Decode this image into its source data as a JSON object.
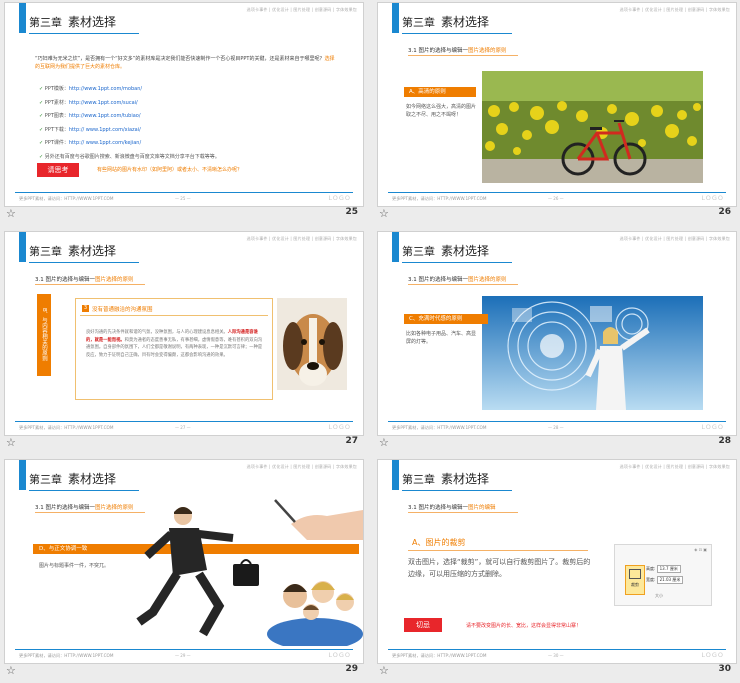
{
  "common": {
    "chapter_label": "第三章",
    "chapter_title": "素材选择",
    "top_nav": "选项卡事件 | 优化设计 | 图片处理 | 创意源码 | 字体效果包",
    "footer_text": "更多PPT素材，请访问：HTTP://WWW.1PPT.COM",
    "logo": "LOGO",
    "section_prefix": "3.1 图片的选择与编辑一",
    "section_highlight": "图片选择的原则",
    "section_highlight_30": "图片的编辑",
    "star_icon": "☆"
  },
  "slides": [
    {
      "page": "25",
      "footer_page": "— 25 —",
      "intro": "“巧妇难为无米之炊”，是否拥有一个“好文多”的素材库是决定我们能否快速制作一个否心视目PPT的关键，还是素材来自于哪里呢？",
      "intro_highlight": "选择的互联网为我们提供了巨大的素材仓库。",
      "links": [
        {
          "label": "PPT模板：",
          "url": "http://www.1ppt.com/moban/"
        },
        {
          "label": "PPT素材：",
          "url": "http://www.1ppt.com/sucai/"
        },
        {
          "label": "PPT图表：",
          "url": "http://www.1ppt.com/tubiao/"
        },
        {
          "label": "PPT下载：",
          "url": "http://   www.1ppt.com/xiazai/"
        },
        {
          "label": "PPT课件：",
          "url": "http://   www.1ppt.com/kejian/"
        }
      ],
      "extra": "另外还有百度与谷歌图片搜索、新浪微盘与百度文库等文档分享平台下载等等。",
      "think_button": "请思考",
      "think_text": "有些网站的图片有水印（如阿里阿）或者太小、不清晰怎么办呢？"
    },
    {
      "page": "26",
      "footer_page": "— 26 —",
      "label": "A、高清的原则",
      "text": "如今网络这么强大，高清的图片取之不尽、用之不竭呀！"
    },
    {
      "page": "27",
      "footer_page": "— 27 —",
      "vert_label": "B、与内容相关的原则",
      "box_title": "没有普通融洽的沟通氛围",
      "box_num": "3",
      "box_text_before": "良好沟通的先决条件就和谐的气氛，没种氛围，与人的心理建设息息相关。",
      "box_text_red": "人际沟通是容谁的，就是一能而视。",
      "box_text_after": "和莫为通者的态度善事无私，有事甚细，虚情假意等，难有甚积的双向沟通氛围。自身部件的氛围下，人们全都是敬谢说明，有两种表现，一种是沉默可言律；一种是反应，致力于证明自己正确，目有时会变得偏颇，这都会影响沟通的效果。"
    },
    {
      "page": "28",
      "footer_page": "— 28 —",
      "label": "C、充满时代感的原则",
      "text": "比如各种电子用品、汽车、高显屏的灯等。"
    },
    {
      "page": "29",
      "footer_page": "— 29 —",
      "label": "D、与正文协调一致",
      "text": "图片与标题事件一件，不突兀。"
    },
    {
      "page": "30",
      "footer_page": "— 30 —",
      "label": "A、图片的裁剪",
      "text": "双击图片，选择“裁剪”，就可以自行裁剪图片了。裁剪后的边缘，可以用压缩的方式删除。",
      "ui_h_label": "高度:",
      "ui_h_value": "13.7 厘米",
      "ui_w_label": "宽度:",
      "ui_w_value": "21.03 厘米",
      "ui_crop": "裁剪",
      "ui_size": "大小",
      "cut_button": "切忌",
      "cut_text": "请不要改变图片的长、宽比，这样会显得非常山寨！"
    }
  ]
}
